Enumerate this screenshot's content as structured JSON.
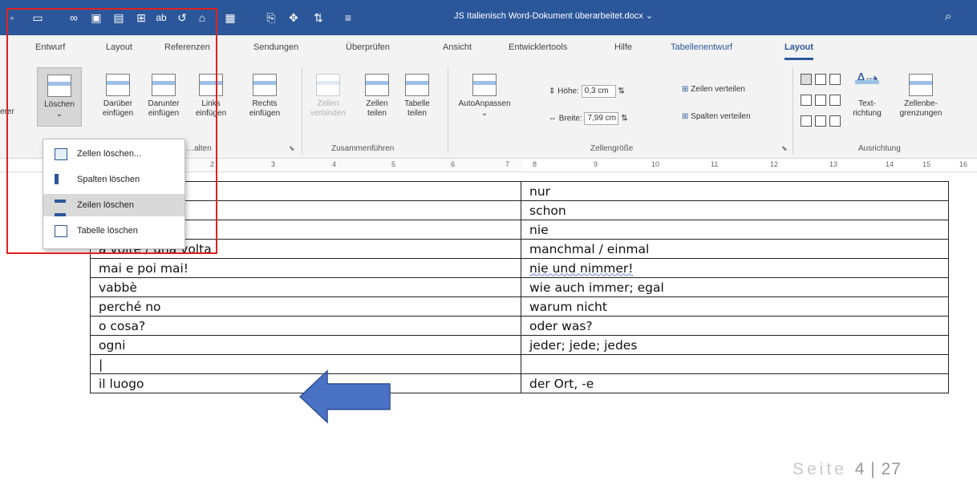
{
  "title_bar": {
    "document_title": "JS Italienisch Word-Dokument überarbeitet.docx",
    "title_dropdown": "⌄",
    "qat_icons": [
      "autosave-icon",
      "new-document-icon",
      "link-icon",
      "clipboard-icon",
      "image-icon",
      "table-grid-icon",
      "ab-icon",
      "undo-icon",
      "paste-icon",
      "insert-icon",
      "read-mode-icon",
      "move-icon",
      "sort-icon",
      "customize-icon"
    ],
    "accent_color": "#2b579a"
  },
  "tabs": [
    "Entwurf",
    "Layout",
    "Referenzen",
    "Sendungen",
    "Überprüfen",
    "Ansicht",
    "Entwicklertools",
    "Hilfe",
    "Tabellenentwurf",
    "Layout"
  ],
  "ribbon": {
    "left_clipped_label": "erer",
    "loeschen": [
      "Löschen",
      "⌄"
    ],
    "rows_cols": [
      {
        "l1": "Darüber",
        "l2": "einfügen"
      },
      {
        "l1": "Darunter",
        "l2": "einfügen"
      },
      {
        "l1": "Links",
        "l2": "einfügen"
      },
      {
        "l1": "Rechts",
        "l2": "einfügen"
      }
    ],
    "rows_cols_group": "…alten",
    "merge": [
      {
        "l1": "Zellen",
        "l2": "verbinden"
      },
      {
        "l1": "Zellen",
        "l2": "teilen"
      },
      {
        "l1": "Tabelle",
        "l2": "teilen"
      }
    ],
    "merge_group": "Zusammenführen",
    "autofit": "AutoAnpassen",
    "height_label": "Höhe:",
    "height_value": "0,3 cm",
    "width_label": "Breite:",
    "width_value": "7,99 cm",
    "distribute_rows": "Zeilen verteilen",
    "distribute_cols": "Spalten verteilen",
    "cellsize_group": "Zellengröße",
    "text_direction": {
      "l1": "Text-",
      "l2": "richtung"
    },
    "cell_margins": {
      "l1": "Zellenbe-",
      "l2": "grenzungen"
    },
    "align_group": "Ausrichtung"
  },
  "ruler": [
    "1",
    "2",
    "3",
    "4",
    "5",
    "6",
    "7",
    "8",
    "9",
    "10",
    "11",
    "12",
    "13",
    "14",
    "15",
    "16"
  ],
  "delete_menu": [
    {
      "label": "Zellen löschen...",
      "icon": "delete-cells-icon"
    },
    {
      "label": "Spalten löschen",
      "icon": "delete-columns-icon"
    },
    {
      "label": "Zeilen löschen",
      "icon": "delete-rows-icon"
    },
    {
      "label": "Tabelle löschen",
      "icon": "delete-table-icon"
    }
  ],
  "table_rows": [
    [
      "",
      "nur"
    ],
    [
      "",
      "schon"
    ],
    [
      "",
      "nie"
    ],
    [
      "a volte / una volta",
      "manchmal / einmal"
    ],
    [
      "mai e poi mai!",
      "nie und nimmer!"
    ],
    [
      "vabbè",
      "wie auch immer; egal"
    ],
    [
      "perché no",
      "warum nicht"
    ],
    [
      "o cosa?",
      "oder was?"
    ],
    [
      "ogni",
      "jeder; jede; jedes"
    ],
    [
      "|",
      ""
    ],
    [
      "il luogo",
      "der Ort, -e"
    ]
  ],
  "footer": {
    "seite": "Seite",
    "page": "4 | 27"
  },
  "annotation_colors": {
    "box": "#e02020",
    "arrow": "#4a72c4"
  }
}
